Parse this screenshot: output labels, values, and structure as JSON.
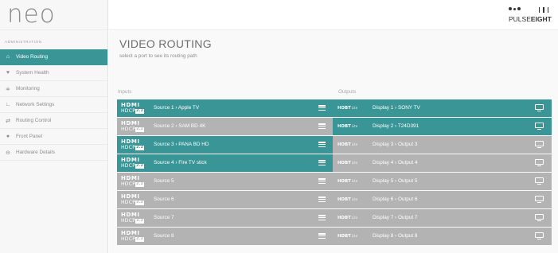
{
  "app": {
    "logo_text": "neo",
    "brand_text_light": "PULSE",
    "brand_text_bold": "EIGHT"
  },
  "sidebar": {
    "section_label": "ADMINISTRATION",
    "items": [
      {
        "label": "Video Routing",
        "icon": "home-icon",
        "active": true
      },
      {
        "label": "System Health",
        "icon": "heart-icon",
        "active": false
      },
      {
        "label": "Monitoring",
        "icon": "chart-icon",
        "active": false
      },
      {
        "label": "Network Settings",
        "icon": "network-icon",
        "active": false
      },
      {
        "label": "Routing Control",
        "icon": "sliders-icon",
        "active": false
      },
      {
        "label": "Front Panel",
        "icon": "panel-icon",
        "active": false
      },
      {
        "label": "Hardware Details",
        "icon": "chip-icon",
        "active": false
      }
    ]
  },
  "main": {
    "title": "VIDEO ROUTING",
    "subtitle": "select a port to see its routing path",
    "inputs_label": "Inputs",
    "outputs_label": "Outputs"
  },
  "inputs": [
    {
      "label": "Source 1 › Apple TV",
      "state": "teal"
    },
    {
      "label": "Source 2 › SAM BD 4K",
      "state": "grey"
    },
    {
      "label": "Source 3 › PANA BD HD",
      "state": "teal"
    },
    {
      "label": "Source 4 › Fire TV stick",
      "state": "teal"
    },
    {
      "label": "Source 5",
      "state": "grey"
    },
    {
      "label": "Source 6",
      "state": "grey"
    },
    {
      "label": "Source 7",
      "state": "grey"
    },
    {
      "label": "Source 8",
      "state": "grey"
    }
  ],
  "outputs": [
    {
      "label": "Display 1 › SONY TV",
      "state": "teal"
    },
    {
      "label": "Display 2 › T24D391",
      "state": "teal"
    },
    {
      "label": "Display 3 › Output 3",
      "state": "grey"
    },
    {
      "label": "Display 4 › Output 4",
      "state": "grey"
    },
    {
      "label": "Display 5 › Output 5",
      "state": "grey"
    },
    {
      "label": "Display 6 › Output 6",
      "state": "grey"
    },
    {
      "label": "Display 7 › Output 7",
      "state": "grey"
    },
    {
      "label": "Display 8 › Output 8",
      "state": "grey"
    }
  ],
  "badges": {
    "hdmi_line1": "HDMI",
    "hdmi_line2": "HDCP",
    "hdmi_tag": "2.2",
    "hdbt_text": "HDBT",
    "hdbt_suffix": "Lite"
  },
  "colors": {
    "accent": "#3a9696",
    "inactive": "#b3b3b3"
  }
}
